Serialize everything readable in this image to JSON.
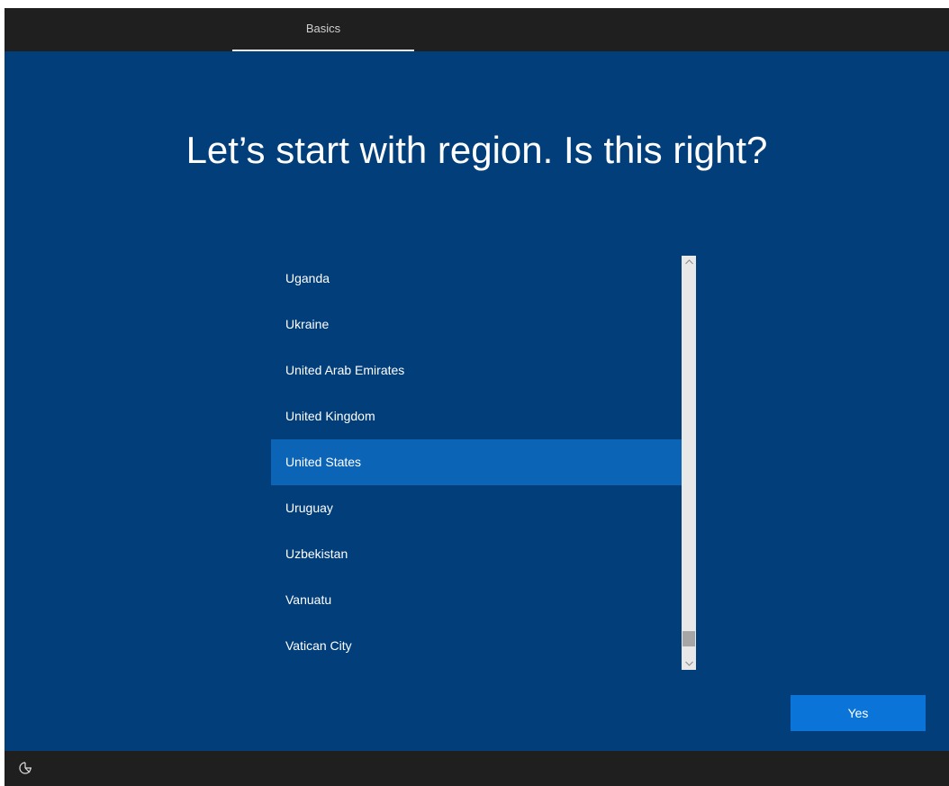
{
  "tabs": [
    {
      "label": "Basics",
      "active": true
    }
  ],
  "page": {
    "heading": "Let’s start with region. Is this right?"
  },
  "region_list": {
    "items": [
      {
        "label": "Uganda"
      },
      {
        "label": "Ukraine"
      },
      {
        "label": "United Arab Emirates"
      },
      {
        "label": "United Kingdom"
      },
      {
        "label": "United States",
        "selected": true
      },
      {
        "label": "Uruguay"
      },
      {
        "label": "Uzbekistan"
      },
      {
        "label": "Vanuatu"
      },
      {
        "label": "Vatican City"
      }
    ],
    "selected": "United States"
  },
  "actions": {
    "yes_label": "Yes"
  },
  "icons": {
    "scroll_up": "chevron-up-icon",
    "scroll_down": "chevron-down-icon",
    "accessibility": "ease-of-access-icon"
  },
  "colors": {
    "background": "#023e7a",
    "selected_item": "#0b64b6",
    "primary_button": "#0b74d8",
    "chrome": "#1f1f1f"
  }
}
